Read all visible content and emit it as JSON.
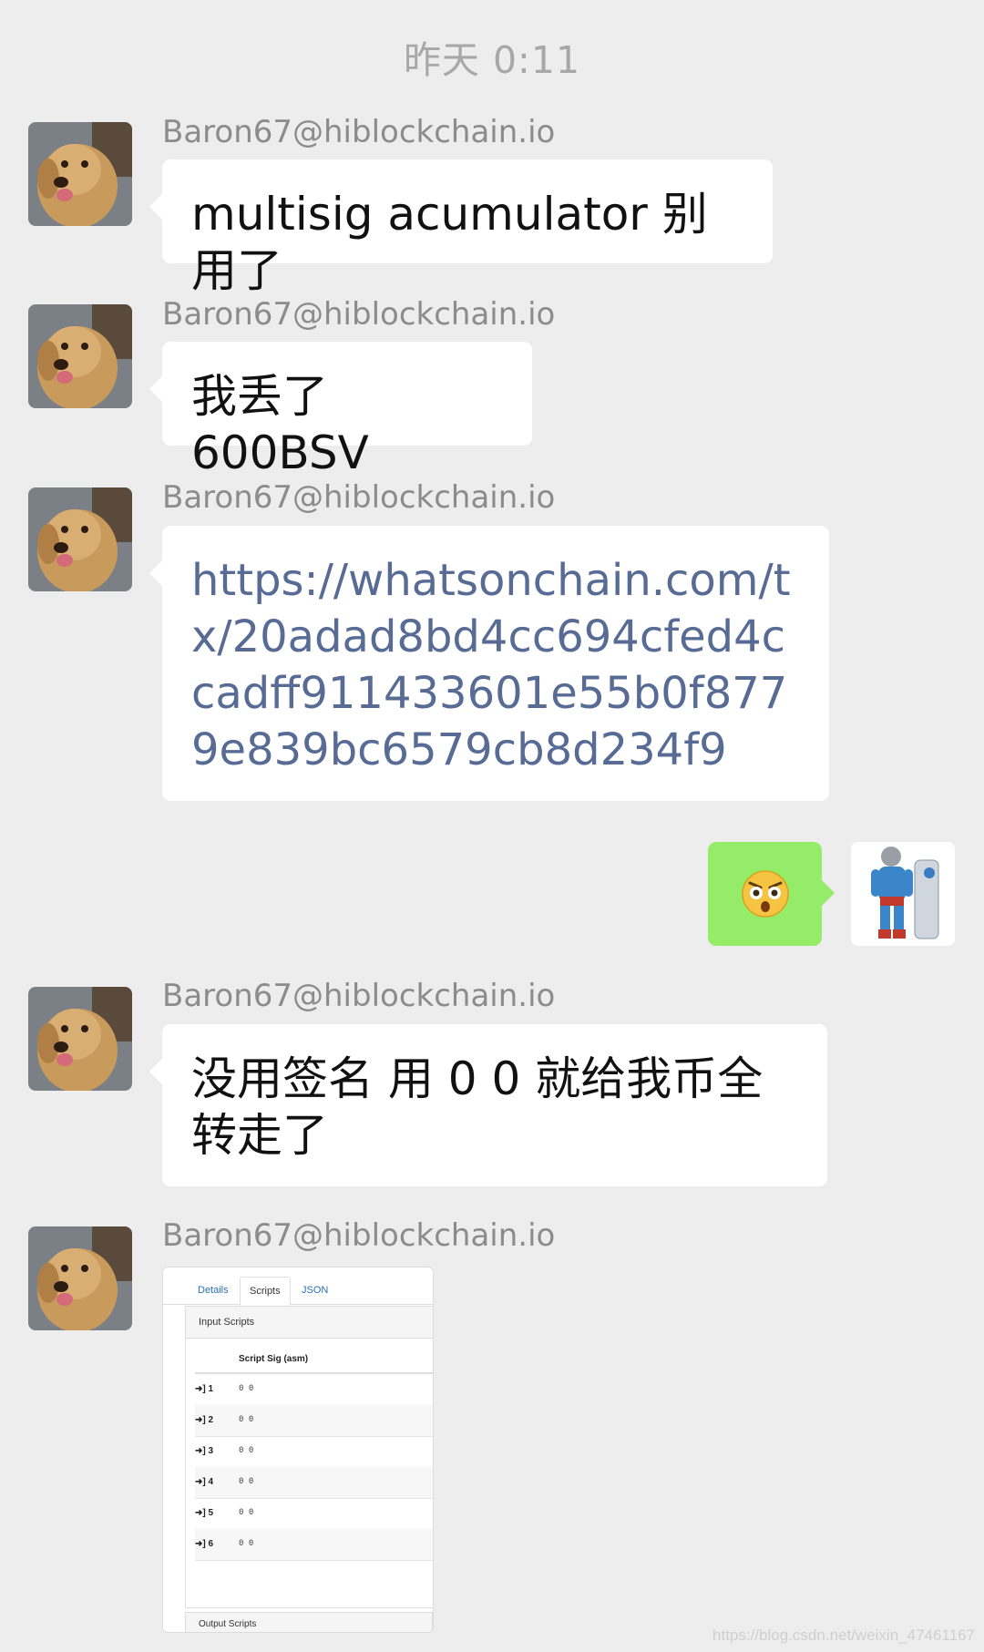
{
  "timestamp": "昨天 0:11",
  "messages": [
    {
      "sender": "Baron67@hiblockchain.io",
      "text": "multisig acumulator 别用了"
    },
    {
      "sender": "Baron67@hiblockchain.io",
      "text": "我丢了600BSV"
    },
    {
      "sender": "Baron67@hiblockchain.io",
      "text": "https://whatsonchain.com/tx/20adad8bd4cc694cfed4ccadff911433601e55b0f8779e839bc6579cb8d234f9"
    },
    {
      "sender": "Baron67@hiblockchain.io",
      "text": "没用签名 用 0 0 就给我币全转走了"
    },
    {
      "sender": "Baron67@hiblockchain.io"
    }
  ],
  "my_reply": {
    "emoji": "shocked-face"
  },
  "screenshot": {
    "tabs": [
      "Details",
      "Scripts",
      "JSON"
    ],
    "panel_title": "Input Scripts",
    "column": "Script Sig (asm)",
    "rows": [
      {
        "num": "1",
        "value": "0 0"
      },
      {
        "num": "2",
        "value": "0 0"
      },
      {
        "num": "3",
        "value": "0 0"
      },
      {
        "num": "4",
        "value": "0 0"
      },
      {
        "num": "5",
        "value": "0 0"
      },
      {
        "num": "6",
        "value": "0 0"
      }
    ],
    "next_section": "Output Scripts"
  },
  "watermark": "https://blog.csdn.net/weixin_47461167"
}
